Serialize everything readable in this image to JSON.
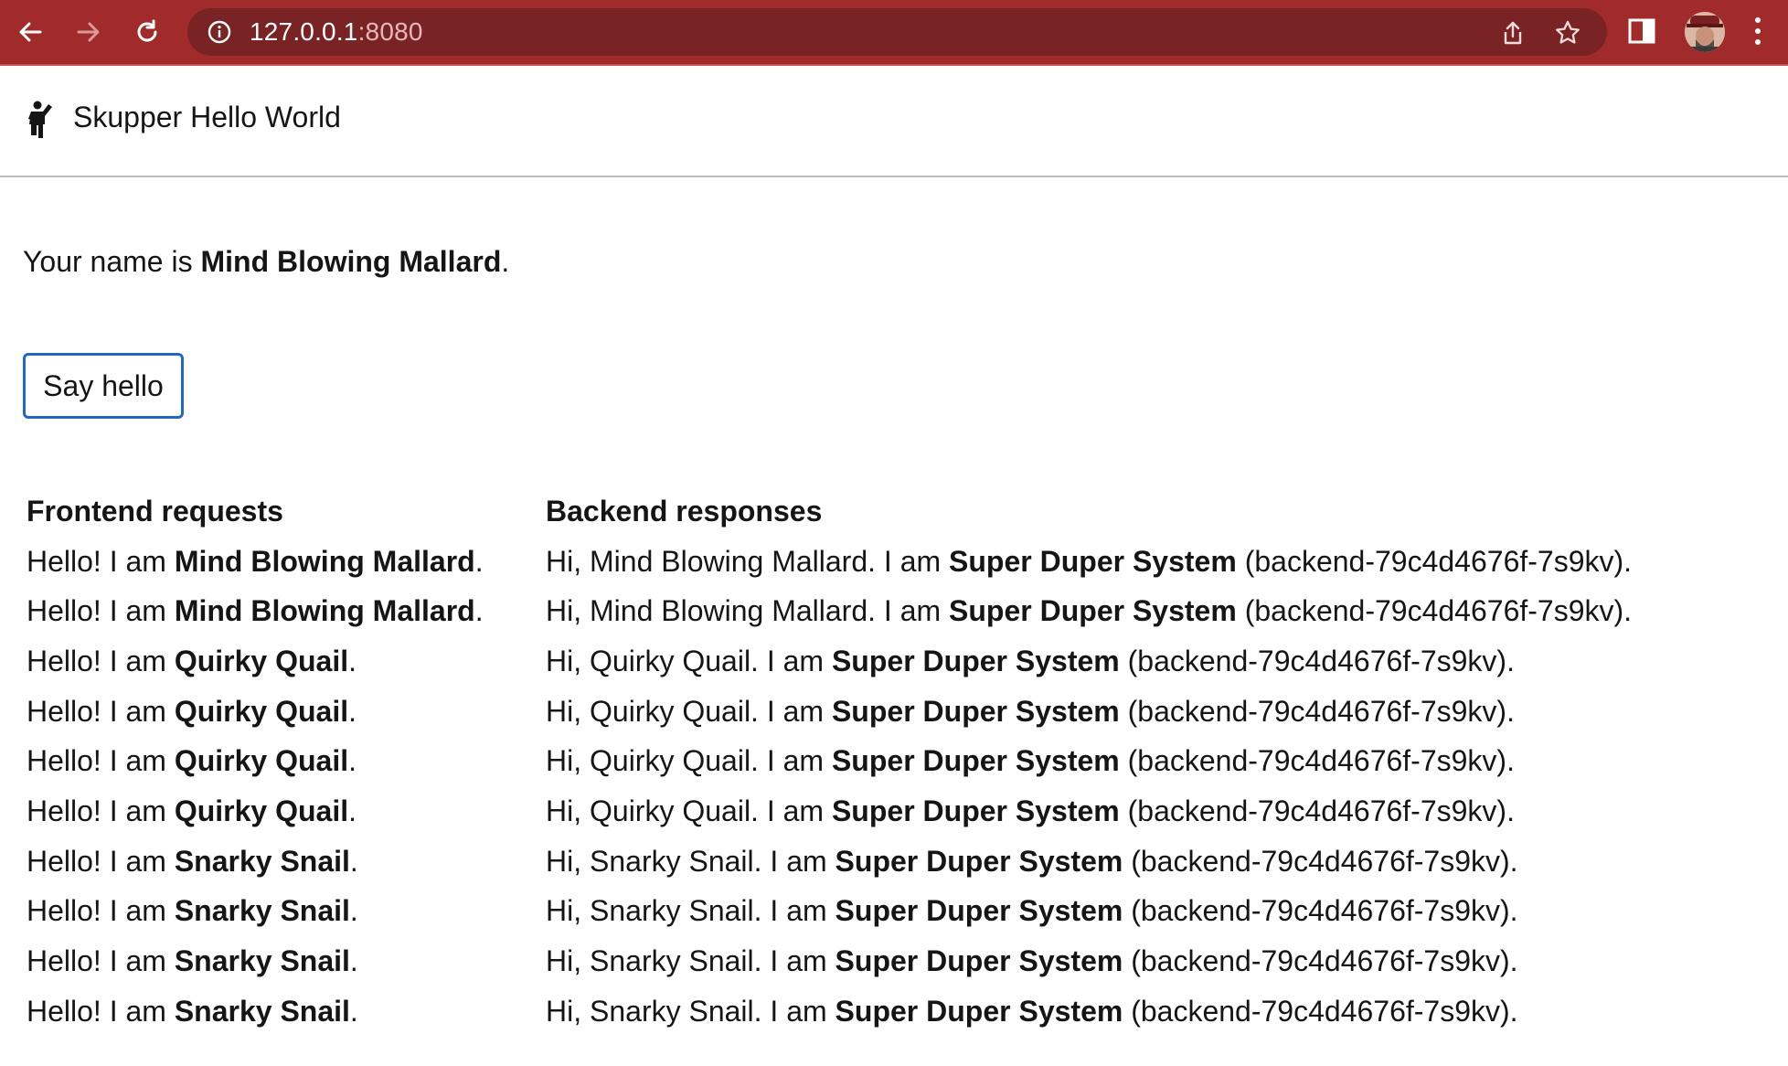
{
  "browser": {
    "url_host": "127.0.0.1",
    "url_port": ":8080",
    "theme_color": "#a12a2a"
  },
  "header": {
    "title": "Skupper Hello World",
    "icon": "person-waving-icon"
  },
  "name_line": {
    "prefix": "Your name is ",
    "name": "Mind Blowing Mallard",
    "suffix": "."
  },
  "say_hello_label": "Say hello",
  "table": {
    "headers": [
      "Frontend requests",
      "Backend responses"
    ],
    "rows": [
      {
        "req_prefix": "Hello! I am ",
        "req_name": "Mind Blowing Mallard",
        "req_suffix": ".",
        "res_prefix": "Hi, Mind Blowing Mallard. I am ",
        "res_system": "Super Duper System",
        "res_suffix": " (backend-79c4d4676f-7s9kv)."
      },
      {
        "req_prefix": "Hello! I am ",
        "req_name": "Mind Blowing Mallard",
        "req_suffix": ".",
        "res_prefix": "Hi, Mind Blowing Mallard. I am ",
        "res_system": "Super Duper System",
        "res_suffix": " (backend-79c4d4676f-7s9kv)."
      },
      {
        "req_prefix": "Hello! I am ",
        "req_name": "Quirky Quail",
        "req_suffix": ".",
        "res_prefix": "Hi, Quirky Quail. I am ",
        "res_system": "Super Duper System",
        "res_suffix": " (backend-79c4d4676f-7s9kv)."
      },
      {
        "req_prefix": "Hello! I am ",
        "req_name": "Quirky Quail",
        "req_suffix": ".",
        "res_prefix": "Hi, Quirky Quail. I am ",
        "res_system": "Super Duper System",
        "res_suffix": " (backend-79c4d4676f-7s9kv)."
      },
      {
        "req_prefix": "Hello! I am ",
        "req_name": "Quirky Quail",
        "req_suffix": ".",
        "res_prefix": "Hi, Quirky Quail. I am ",
        "res_system": "Super Duper System",
        "res_suffix": " (backend-79c4d4676f-7s9kv)."
      },
      {
        "req_prefix": "Hello! I am ",
        "req_name": "Quirky Quail",
        "req_suffix": ".",
        "res_prefix": "Hi, Quirky Quail. I am ",
        "res_system": "Super Duper System",
        "res_suffix": " (backend-79c4d4676f-7s9kv)."
      },
      {
        "req_prefix": "Hello! I am ",
        "req_name": "Snarky Snail",
        "req_suffix": ".",
        "res_prefix": "Hi, Snarky Snail. I am ",
        "res_system": "Super Duper System",
        "res_suffix": " (backend-79c4d4676f-7s9kv)."
      },
      {
        "req_prefix": "Hello! I am ",
        "req_name": "Snarky Snail",
        "req_suffix": ".",
        "res_prefix": "Hi, Snarky Snail. I am ",
        "res_system": "Super Duper System",
        "res_suffix": " (backend-79c4d4676f-7s9kv)."
      },
      {
        "req_prefix": "Hello! I am ",
        "req_name": "Snarky Snail",
        "req_suffix": ".",
        "res_prefix": "Hi, Snarky Snail. I am ",
        "res_system": "Super Duper System",
        "res_suffix": " (backend-79c4d4676f-7s9kv)."
      },
      {
        "req_prefix": "Hello! I am ",
        "req_name": "Snarky Snail",
        "req_suffix": ".",
        "res_prefix": "Hi, Snarky Snail. I am ",
        "res_system": "Super Duper System",
        "res_suffix": " (backend-79c4d4676f-7s9kv)."
      }
    ]
  }
}
